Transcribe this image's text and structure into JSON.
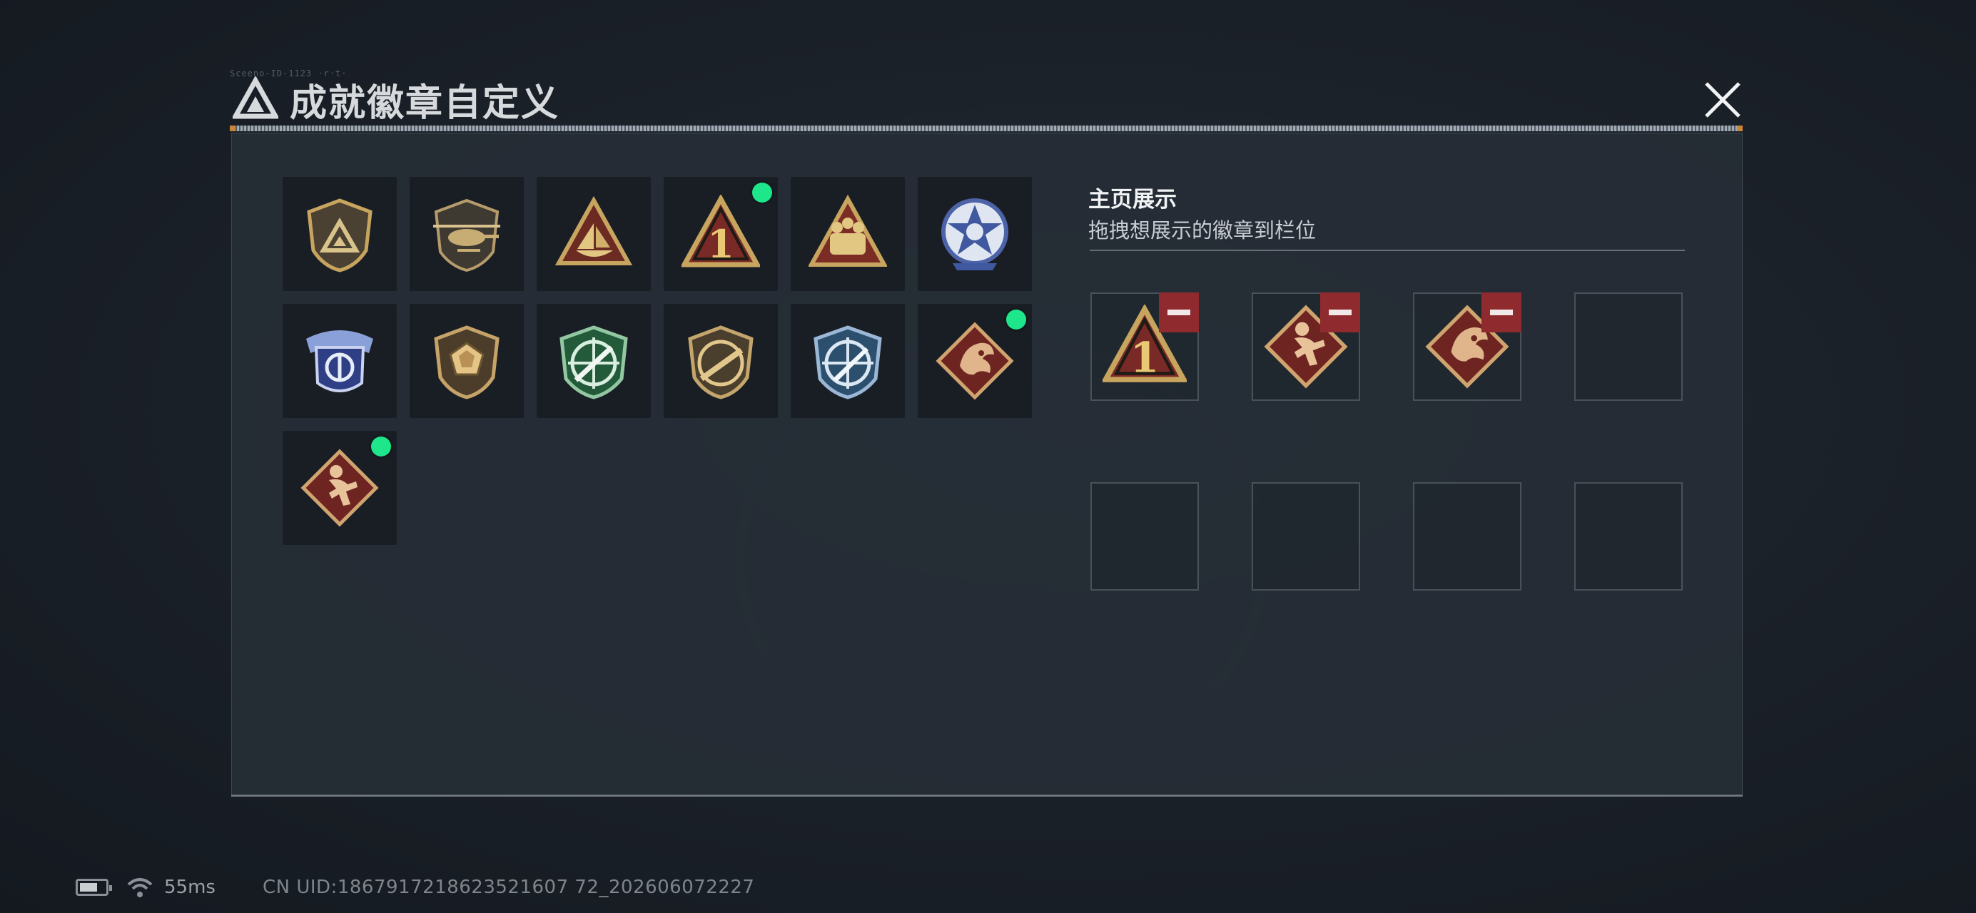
{
  "header": {
    "title": "成就徽章自定义",
    "tag": "Sceeno-ID-1123 ·r·t·",
    "close_label": "×"
  },
  "badges": [
    {
      "icon": "shield-triangle-badge-icon",
      "is_new": false
    },
    {
      "icon": "helicopter-badge-icon",
      "is_new": false
    },
    {
      "icon": "ship-triangle-badge-icon",
      "is_new": false
    },
    {
      "icon": "number-one-triangle-badge-icon",
      "is_new": true
    },
    {
      "icon": "soldiers-triangle-badge-icon",
      "is_new": false
    },
    {
      "icon": "star-skull-emblem-icon",
      "is_new": false
    },
    {
      "icon": "blue-winged-shield-badge-icon",
      "is_new": false
    },
    {
      "icon": "gem-shield-badge-icon",
      "is_new": false
    },
    {
      "icon": "green-crosshair-rifle-badge-icon",
      "is_new": false
    },
    {
      "icon": "rifle-shield-badge-icon",
      "is_new": false
    },
    {
      "icon": "blue-crosshair-knife-badge-icon",
      "is_new": false
    },
    {
      "icon": "dragon-diamond-badge-icon",
      "is_new": true
    },
    {
      "icon": "runner-diamond-badge-icon",
      "is_new": true
    }
  ],
  "showcase": {
    "title": "主页展示",
    "subtitle": "拖拽想展示的徽章到栏位",
    "slots": [
      {
        "icon": "number-one-triangle-badge-icon",
        "filled": true
      },
      {
        "icon": "runner-diamond-badge-icon",
        "filled": true
      },
      {
        "icon": "dragon-diamond-badge-icon",
        "filled": true
      },
      {
        "icon": "",
        "filled": false
      },
      {
        "icon": "",
        "filled": false
      },
      {
        "icon": "",
        "filled": false
      },
      {
        "icon": "",
        "filled": false
      },
      {
        "icon": "",
        "filled": false
      }
    ]
  },
  "status": {
    "ping": "55ms",
    "uid": "CN UID:1867917218623521607 72_202606072227"
  },
  "colors": {
    "new_dot": "#1ee68a",
    "remove": "#8f2a2e",
    "gold": "#c8a55e",
    "crimson": "#7a2a26"
  }
}
